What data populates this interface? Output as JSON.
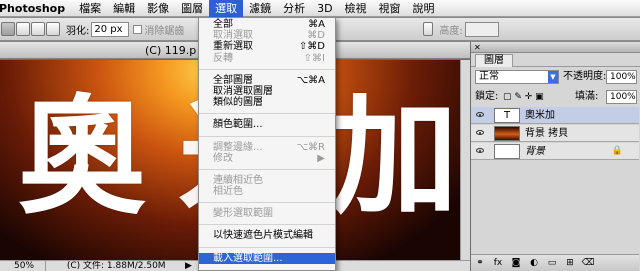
{
  "menubar": {
    "app": "Photoshop",
    "items": [
      "檔案",
      "編輯",
      "影像",
      "圖層",
      "選取",
      "濾鏡",
      "分析",
      "3D",
      "檢視",
      "視窗",
      "說明"
    ]
  },
  "options": {
    "feather_label": "羽化:",
    "feather_value": "20 px",
    "antialias_label": "消除鋸齒",
    "style_partial": "樣",
    "height_label": "高度:"
  },
  "document": {
    "title": "(C) 119.p",
    "canvas_text": [
      "奧",
      "米",
      "加"
    ],
    "zoom": "50%",
    "file_info": "(C) 文件: 1.88M/2.50M"
  },
  "select_menu": {
    "items": [
      {
        "label": "全部",
        "shortcut": "⌘A",
        "disabled": false
      },
      {
        "label": "取消選取",
        "shortcut": "⌘D",
        "disabled": true
      },
      {
        "label": "重新選取",
        "shortcut": "⇧⌘D",
        "disabled": false
      },
      {
        "label": "反轉",
        "shortcut": "⇧⌘I",
        "disabled": true
      },
      {
        "label": "全部圖層",
        "shortcut": "⌥⌘A",
        "disabled": false
      },
      {
        "label": "取消選取圖層",
        "shortcut": "",
        "disabled": false
      },
      {
        "label": "類似的圖層",
        "shortcut": "",
        "disabled": false
      },
      {
        "label": "顏色範圍...",
        "shortcut": "",
        "disabled": false
      },
      {
        "label": "調整邊緣...",
        "shortcut": "⌥⌘R",
        "disabled": true
      },
      {
        "label": "修改",
        "shortcut": "▶",
        "disabled": true
      },
      {
        "label": "連續相近色",
        "shortcut": "",
        "disabled": true
      },
      {
        "label": "相近色",
        "shortcut": "",
        "disabled": true
      },
      {
        "label": "變形選取範圍",
        "shortcut": "",
        "disabled": true
      },
      {
        "label": "以快速遮色片模式編輯",
        "shortcut": "",
        "disabled": false
      },
      {
        "label": "載入選取範圍...",
        "shortcut": "",
        "disabled": false,
        "highlighted": true
      }
    ]
  },
  "layers_panel": {
    "tab": "圖層",
    "blend_mode": "正常",
    "opacity_label": "不透明度:",
    "opacity_value": "100%",
    "lock_label": "鎖定:",
    "fill_label": "填滿:",
    "fill_value": "100%",
    "layers": [
      {
        "name": "奧米加",
        "thumb": "T",
        "selected": true,
        "italic": false
      },
      {
        "name": "背景 拷貝",
        "thumb": "",
        "selected": false,
        "italic": false
      },
      {
        "name": "背景",
        "thumb": "",
        "selected": false,
        "italic": true
      }
    ]
  },
  "colors": {
    "menu_highlight": "#2f63d8",
    "selected_layer": "#c3cee6"
  }
}
